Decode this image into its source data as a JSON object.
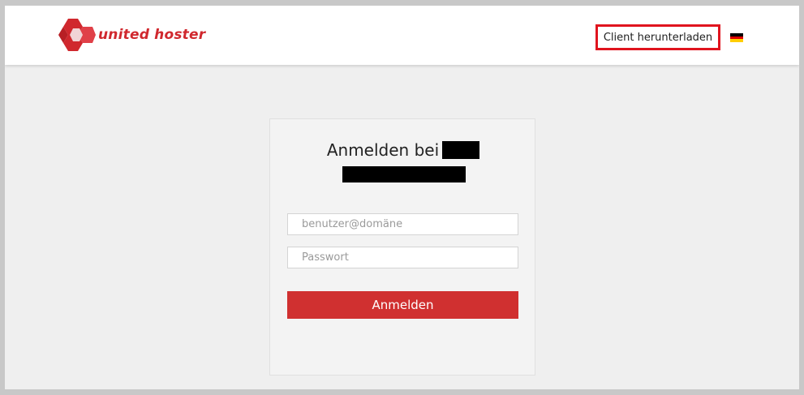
{
  "header": {
    "brand_name": "united hoster",
    "download_client_label": "Client herunterladen",
    "language_flag": "german-flag-icon",
    "brand_color": "#d0282e",
    "highlight_color": "#e0141e"
  },
  "login": {
    "title": "Anmelden bei",
    "username_placeholder": "benutzer@domäne",
    "password_placeholder": "Passwort",
    "submit_label": "Anmelden",
    "submit_color": "#d03030"
  }
}
